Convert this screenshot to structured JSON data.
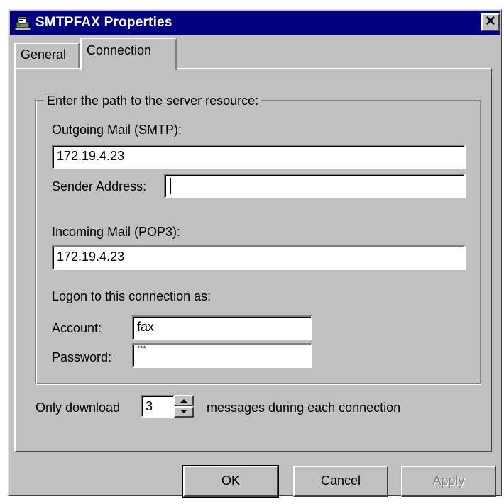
{
  "window": {
    "title": "SMTPFAX Properties",
    "close_glyph": "✕",
    "title_bar_color": "#000080",
    "face_color": "#c0c0c0"
  },
  "tabs": [
    {
      "label": "General",
      "selected": false
    },
    {
      "label": "Connection",
      "selected": true
    }
  ],
  "server_group": {
    "legend": "Enter the path to the server resource:",
    "outgoing_label": "Outgoing Mail (SMTP):",
    "outgoing_value": "172.19.4.23",
    "sender_label": "Sender Address:",
    "sender_value": "",
    "incoming_label": "Incoming Mail (POP3):",
    "incoming_value": "172.19.4.23",
    "logon_label": "Logon to this connection as:",
    "account_label": "Account:",
    "account_value": "fax",
    "password_label": "Password:",
    "password_value": "***"
  },
  "download": {
    "prefix": "Only download",
    "count": "3",
    "suffix": "messages during each connection"
  },
  "buttons": {
    "ok": "OK",
    "cancel": "Cancel",
    "apply": "Apply",
    "apply_enabled": false
  },
  "icons": [
    "fax-icon",
    "close-icon",
    "spin-up-icon",
    "spin-down-icon"
  ]
}
